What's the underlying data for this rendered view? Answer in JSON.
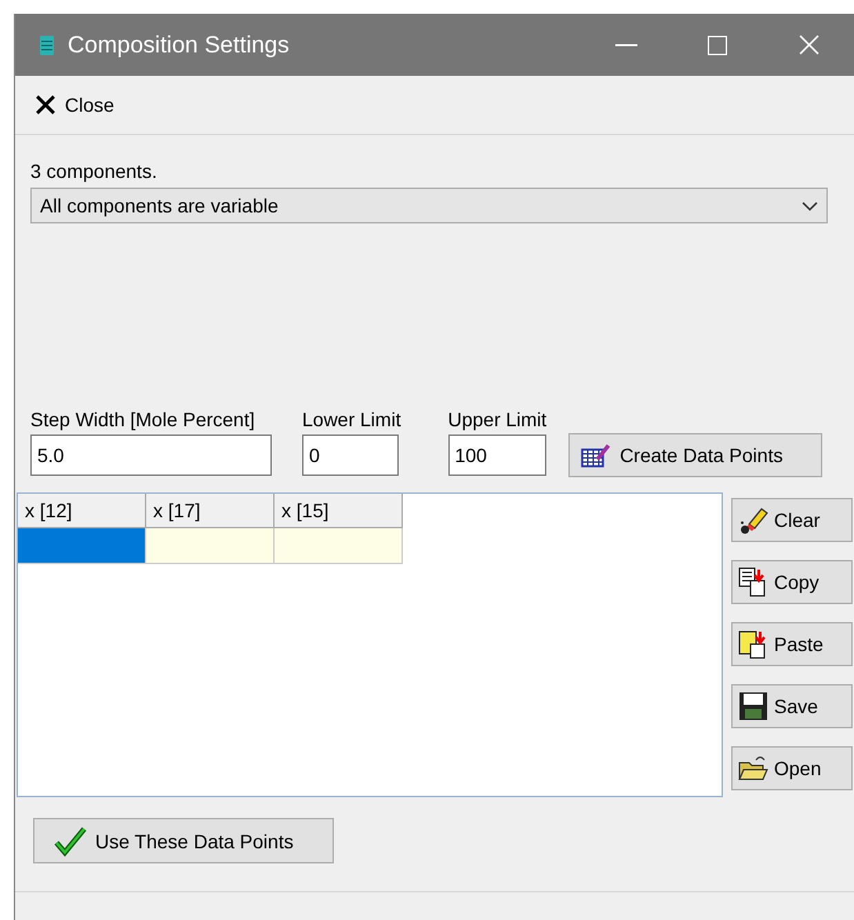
{
  "window": {
    "title": "Composition Settings"
  },
  "toolbar": {
    "close_label": "Close"
  },
  "components_label": "3 components.",
  "mode_dropdown": {
    "value": "All components are variable"
  },
  "step_width": {
    "label": "Step Width [Mole Percent]",
    "value": "5.0"
  },
  "lower_limit": {
    "label": "Lower Limit",
    "value": "0"
  },
  "upper_limit": {
    "label": "Upper Limit",
    "value": "100"
  },
  "create_button": "Create Data Points",
  "grid": {
    "columns": [
      "x [12]",
      "x [17]",
      "x [15]"
    ],
    "rows": [
      {
        "cells": [
          {
            "selected": true
          },
          {
            "selected": false
          },
          {
            "selected": false
          }
        ]
      }
    ]
  },
  "side_buttons": [
    {
      "kind": "clear",
      "label": "Clear"
    },
    {
      "kind": "copy",
      "label": "Copy"
    },
    {
      "kind": "paste",
      "label": "Paste"
    },
    {
      "kind": "save",
      "label": "Save"
    },
    {
      "kind": "open",
      "label": "Open"
    }
  ],
  "use_button": "Use These Data Points"
}
